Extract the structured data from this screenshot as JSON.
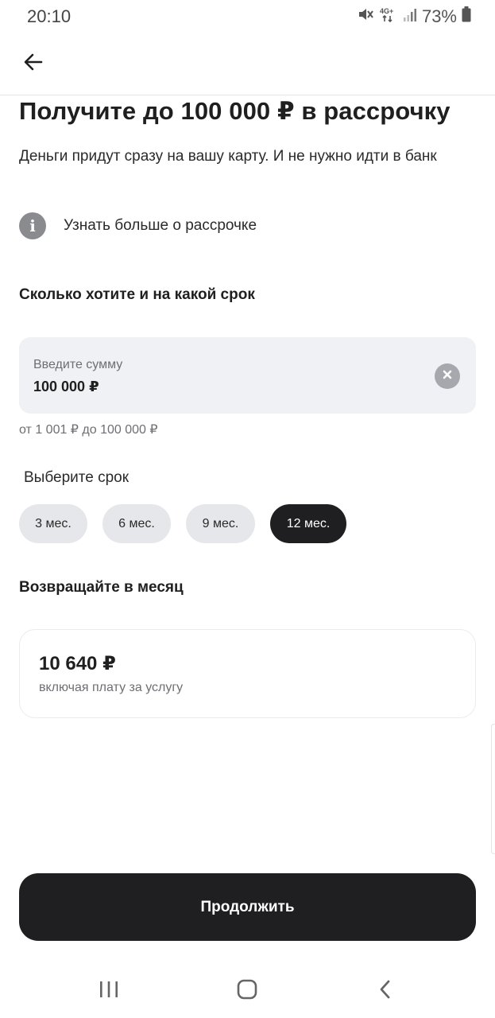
{
  "status_bar": {
    "time": "20:10",
    "network": "4G+",
    "battery": "73%",
    "icons": [
      "mute-icon",
      "network-4g-icon",
      "signal-icon",
      "battery-icon"
    ]
  },
  "header": {
    "back_icon": "arrow-left-icon"
  },
  "title": "Получите до 100 000 ₽ в рассрочку",
  "subtitle": "Деньги придут сразу на вашу карту. И не нужно идти в банк",
  "info_link": {
    "icon": "info-icon",
    "label": "Узнать больше о рассрочке"
  },
  "amount_section": {
    "heading": "Сколько хотите и на какой срок",
    "field_placeholder": "Введите сумму",
    "field_value": "100 000 ₽",
    "clear_icon": "clear-icon",
    "range_hint": "от 1 001 ₽ до 100 000 ₽"
  },
  "term_section": {
    "label": "Выберите срок",
    "options": [
      "3 мес.",
      "6 мес.",
      "9 мес.",
      "12 мес."
    ],
    "selected": "12 мес."
  },
  "result_section": {
    "heading": "Возвращайте в месяц",
    "amount": "10 640 ₽",
    "note": "включая плату за услугу"
  },
  "continue_label": "Продолжить",
  "nav": {
    "icons": [
      "recents-icon",
      "home-icon",
      "back-icon"
    ]
  },
  "colors": {
    "accent_dark": "#1f1f21",
    "field_bg": "#f0f1f4",
    "chip_bg": "#e6e7ea",
    "muted_text": "#6e6f73"
  }
}
